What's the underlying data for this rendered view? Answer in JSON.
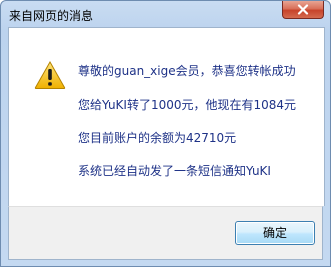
{
  "window": {
    "title": "来自网页的消息"
  },
  "message": {
    "line1": "尊敬的guan_xige会员，恭喜您转帐成功",
    "line2": "您给YuKI转了1000元，他现在有1084元",
    "line3": "您目前账户的余额为42710元",
    "line4": "系统已经自动发了一条短信通知YuKI"
  },
  "buttons": {
    "ok_label": "确定"
  },
  "icons": {
    "dialog_icon": "warning-icon",
    "close_icon": "close-icon"
  },
  "colors": {
    "message_text": "#1e3287",
    "warning_yellow": "#f5c518",
    "close_red": "#c7432b"
  }
}
